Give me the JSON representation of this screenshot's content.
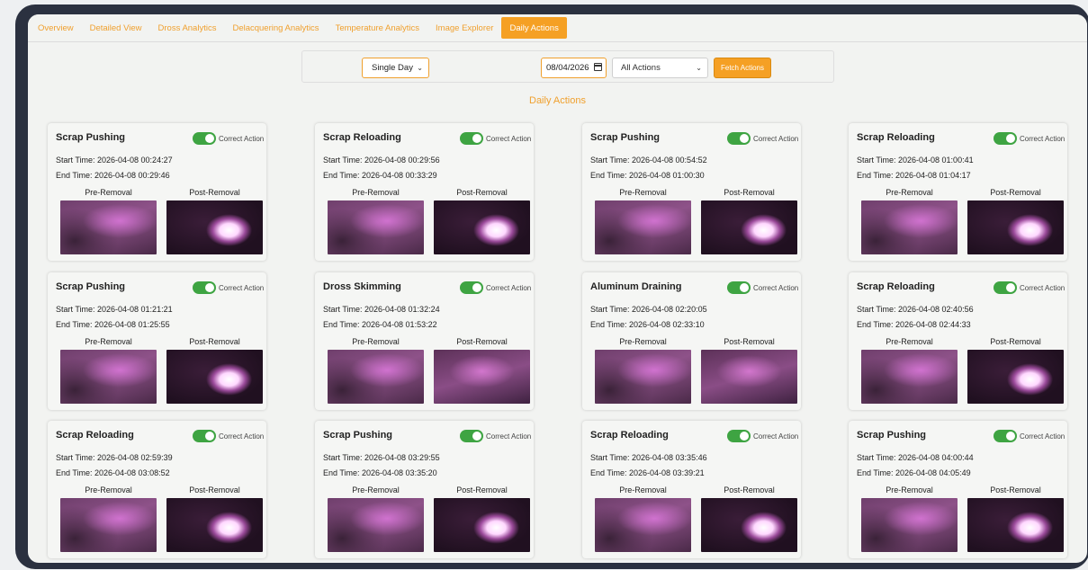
{
  "tabs": [
    {
      "label": "Overview",
      "active": false
    },
    {
      "label": "Detailed View",
      "active": false
    },
    {
      "label": "Dross Analytics",
      "active": false
    },
    {
      "label": "Delacquering Analytics",
      "active": false
    },
    {
      "label": "Temperature Analytics",
      "active": false
    },
    {
      "label": "Image Explorer",
      "active": false
    },
    {
      "label": "Daily Actions",
      "active": true
    }
  ],
  "controls": {
    "mode": "Single Day",
    "date": "08/04/2026",
    "action_filter": "All Actions",
    "fetch_label": "Fetch Actions"
  },
  "heading": "Daily Actions",
  "labels": {
    "correct": "Correct Action",
    "pre": "Pre-Removal",
    "post": "Post-Removal"
  },
  "colors": {
    "accent": "#f5a024",
    "toggle_on": "#3ea442"
  },
  "cards": [
    {
      "title": "Scrap Pushing",
      "start": "Start Time: 2026-04-08 00:24:27",
      "end": "End Time: 2026-04-08 00:29:46",
      "correct": true
    },
    {
      "title": "Scrap Reloading",
      "start": "Start Time: 2026-04-08 00:29:56",
      "end": "End Time: 2026-04-08 00:33:29",
      "correct": true
    },
    {
      "title": "Scrap Pushing",
      "start": "Start Time: 2026-04-08 00:54:52",
      "end": "End Time: 2026-04-08 01:00:30",
      "correct": true
    },
    {
      "title": "Scrap Reloading",
      "start": "Start Time: 2026-04-08 01:00:41",
      "end": "End Time: 2026-04-08 01:04:17",
      "correct": true
    },
    {
      "title": "Scrap Pushing",
      "start": "Start Time: 2026-04-08 01:21:21",
      "end": "End Time: 2026-04-08 01:25:55",
      "correct": true
    },
    {
      "title": "Dross Skimming",
      "start": "Start Time: 2026-04-08 01:32:24",
      "end": "End Time: 2026-04-08 01:53:22",
      "correct": true
    },
    {
      "title": "Aluminum Draining",
      "start": "Start Time: 2026-04-08 02:20:05",
      "end": "End Time: 2026-04-08 02:33:10",
      "correct": true
    },
    {
      "title": "Scrap Reloading",
      "start": "Start Time: 2026-04-08 02:40:56",
      "end": "End Time: 2026-04-08 02:44:33",
      "correct": true
    },
    {
      "title": "Scrap Reloading",
      "start": "Start Time: 2026-04-08 02:59:39",
      "end": "End Time: 2026-04-08 03:08:52",
      "correct": true
    },
    {
      "title": "Scrap Pushing",
      "start": "Start Time: 2026-04-08 03:29:55",
      "end": "End Time: 2026-04-08 03:35:20",
      "correct": true
    },
    {
      "title": "Scrap Reloading",
      "start": "Start Time: 2026-04-08 03:35:46",
      "end": "End Time: 2026-04-08 03:39:21",
      "correct": true
    },
    {
      "title": "Scrap Pushing",
      "start": "Start Time: 2026-04-08 04:00:44",
      "end": "End Time: 2026-04-08 04:05:49",
      "correct": true
    }
  ]
}
